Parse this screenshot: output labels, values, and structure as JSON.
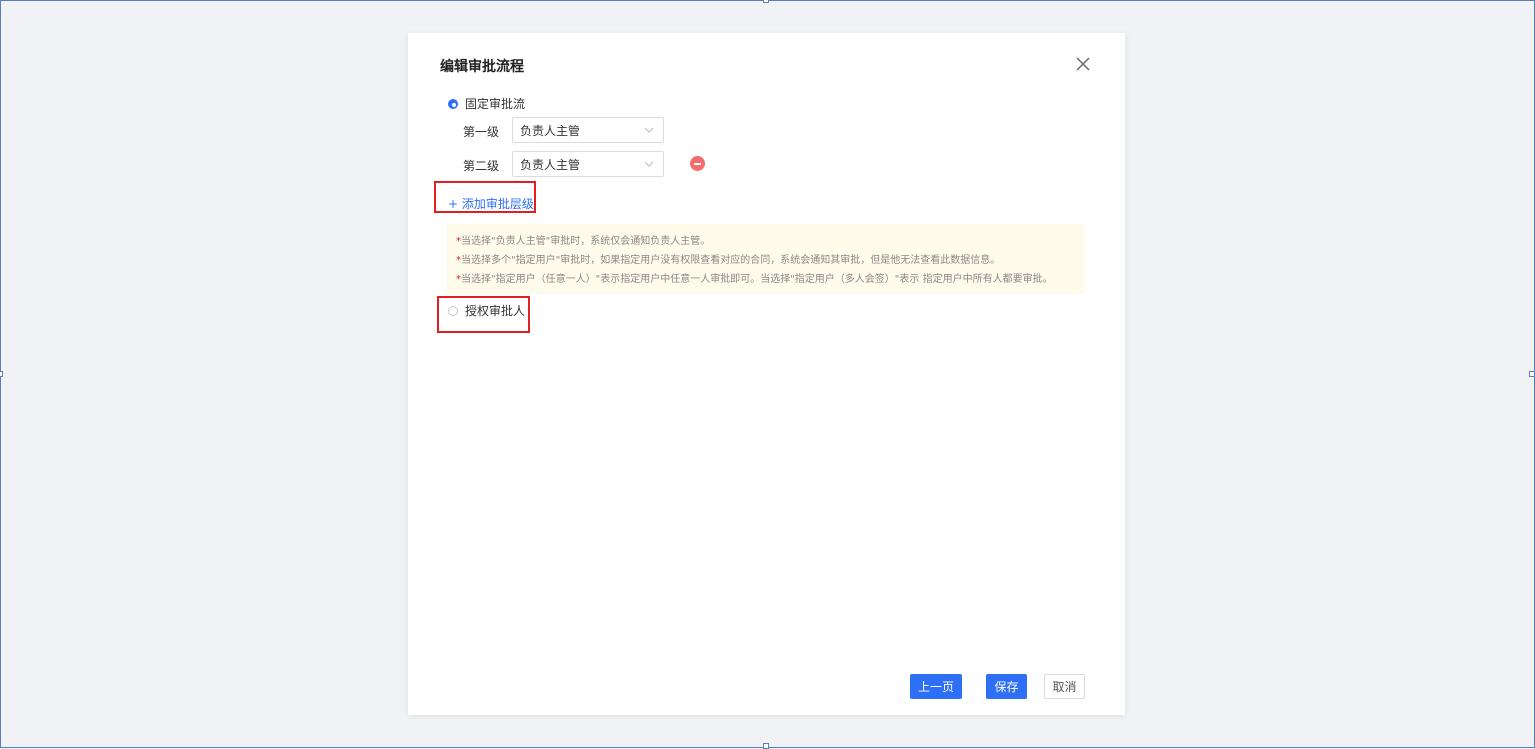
{
  "dialog": {
    "title": "编辑审批流程",
    "fixed_flow": {
      "label": "固定审批流",
      "checked": true
    },
    "levels": [
      {
        "label": "第一级",
        "value": "负责人主管",
        "removable": false
      },
      {
        "label": "第二级",
        "value": "负责人主管",
        "removable": true
      }
    ],
    "add_level_label": "+ 添加审批层级",
    "notes": [
      "当选择\"负责人主管\"审批时，系统仅会通知负责人主管。",
      "当选择多个\"指定用户\"审批时，如果指定用户没有权限查看对应的合同，系统会通知其审批，但是他无法查看此数据信息。",
      "当选择\"指定用户（任意一人）\"表示指定用户中任意一人审批即可。当选择\"指定用户（多人会签）\"表示 指定用户中所有人都要审批。"
    ],
    "note_marker": "*",
    "authorize": {
      "label": "授权审批人",
      "checked": false
    },
    "buttons": {
      "prev": "上一页",
      "save": "保存",
      "cancel": "取消"
    }
  },
  "colors": {
    "primary": "#2d6ff7",
    "danger": "#f56c6c",
    "highlight": "#e02020",
    "notice_bg": "#fffbea"
  },
  "icons": {
    "close": "close-icon",
    "chevron": "chevron-down-icon",
    "remove": "minus-circle-icon"
  }
}
